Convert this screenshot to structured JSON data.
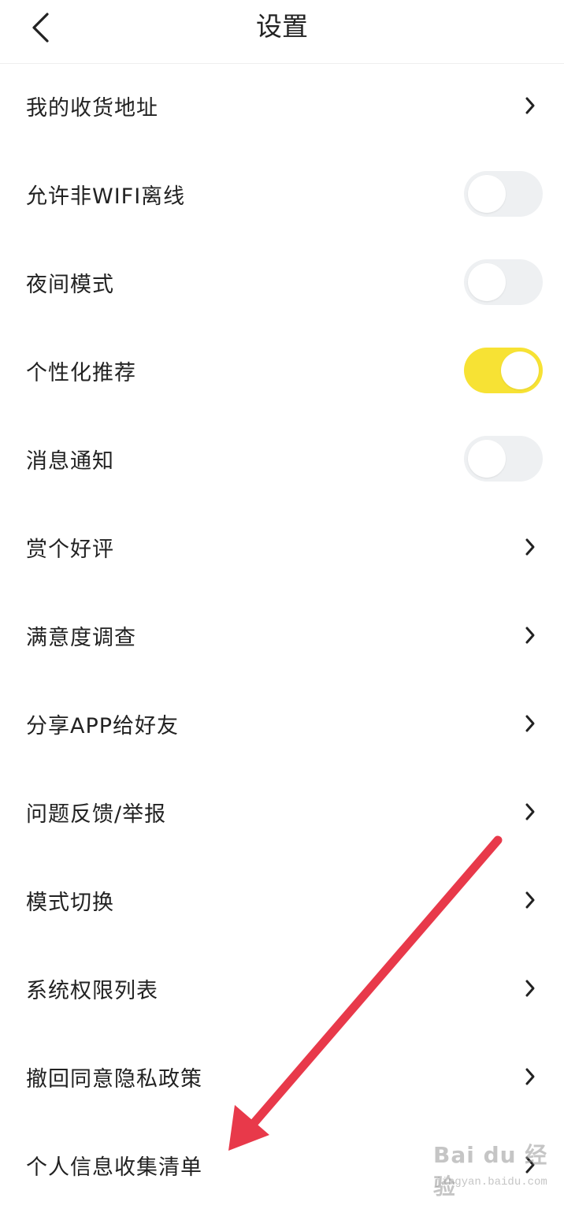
{
  "header": {
    "title": "设置",
    "back_icon": "chevron-left-icon"
  },
  "settings": [
    {
      "label": "我的收货地址",
      "control": "chevron"
    },
    {
      "label": "允许非WIFI离线",
      "control": "toggle",
      "on": false
    },
    {
      "label": "夜间模式",
      "control": "toggle",
      "on": false
    },
    {
      "label": "个性化推荐",
      "control": "toggle",
      "on": true
    },
    {
      "label": "消息通知",
      "control": "toggle",
      "on": false
    },
    {
      "label": "赏个好评",
      "control": "chevron"
    },
    {
      "label": "满意度调查",
      "control": "chevron"
    },
    {
      "label": "分享APP给好友",
      "control": "chevron"
    },
    {
      "label": "问题反馈/举报",
      "control": "chevron"
    },
    {
      "label": "模式切换",
      "control": "chevron"
    },
    {
      "label": "系统权限列表",
      "control": "chevron"
    },
    {
      "label": "撤回同意隐私政策",
      "control": "chevron"
    },
    {
      "label": "个人信息收集清单",
      "control": "chevron"
    }
  ],
  "colors": {
    "toggle_on": "#f7e234",
    "toggle_off": "#eef0f2",
    "annotation_arrow": "#e8394a"
  },
  "watermark": {
    "brand": "Bai du 经验",
    "url": "jingyan.baidu.com"
  }
}
